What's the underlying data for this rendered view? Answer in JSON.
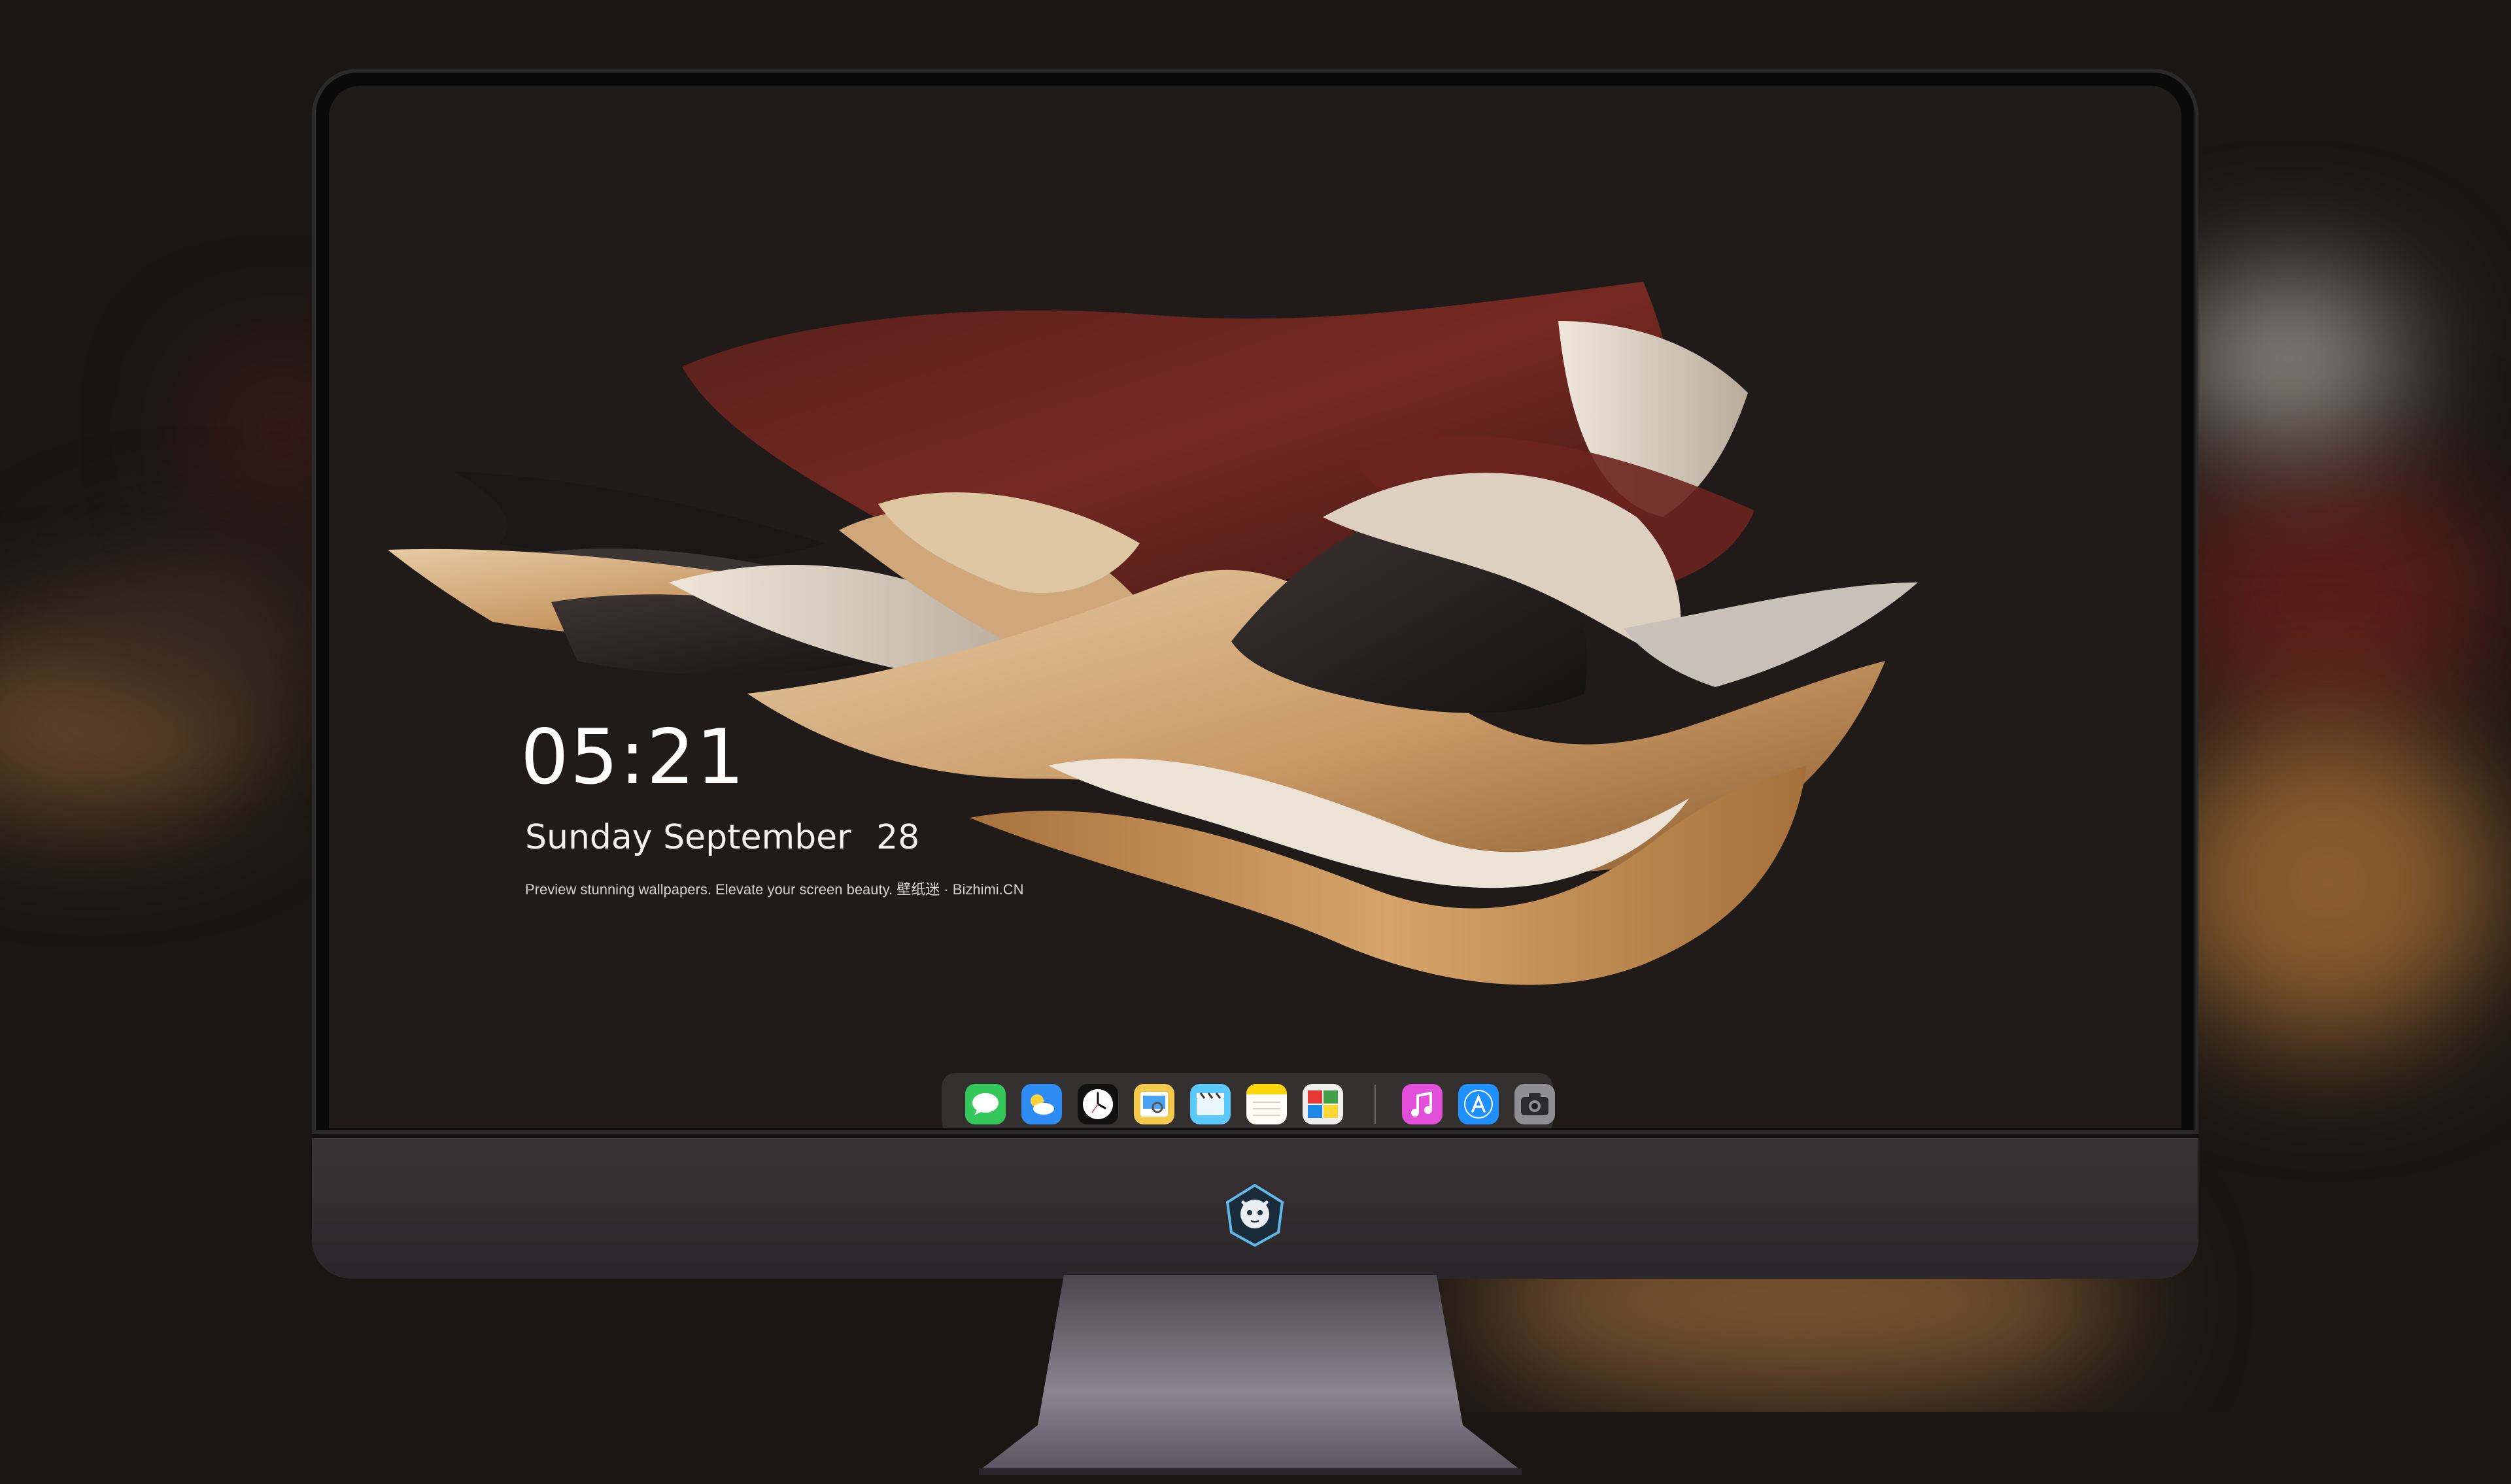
{
  "screen": {
    "clock_time": "05:21",
    "clock_weekday": "Sunday",
    "clock_month": "September",
    "clock_day": "28",
    "caption": "Preview stunning wallpapers. Elevate your screen beauty. 壁纸迷 · Bizhimi.CN"
  },
  "dock": {
    "apps": [
      {
        "icon": "messages-icon",
        "color": "#34c759"
      },
      {
        "icon": "weather-icon",
        "color": "#2f8cf5"
      },
      {
        "icon": "clock-icon",
        "color": "#ffffff"
      },
      {
        "icon": "preview-icon",
        "color": "#f2c94c"
      },
      {
        "icon": "clips-icon",
        "color": "#5ac8fa"
      },
      {
        "icon": "notes-icon",
        "color": "#ffd60a"
      },
      {
        "icon": "photo-booth-icon",
        "color": "#ffffff"
      },
      {
        "icon": "music-icon",
        "color": "#e24fd8"
      },
      {
        "icon": "app-store-icon",
        "color": "#1e90ff"
      },
      {
        "icon": "camera-icon",
        "color": "#8e8e93"
      }
    ]
  },
  "colors": {
    "background": "#1a1613",
    "screen": "#201b19",
    "fabric_red": "#6e2620",
    "fabric_tan": "#c89a66",
    "fabric_cream": "#d9cdbf",
    "chin": "#352f32"
  }
}
